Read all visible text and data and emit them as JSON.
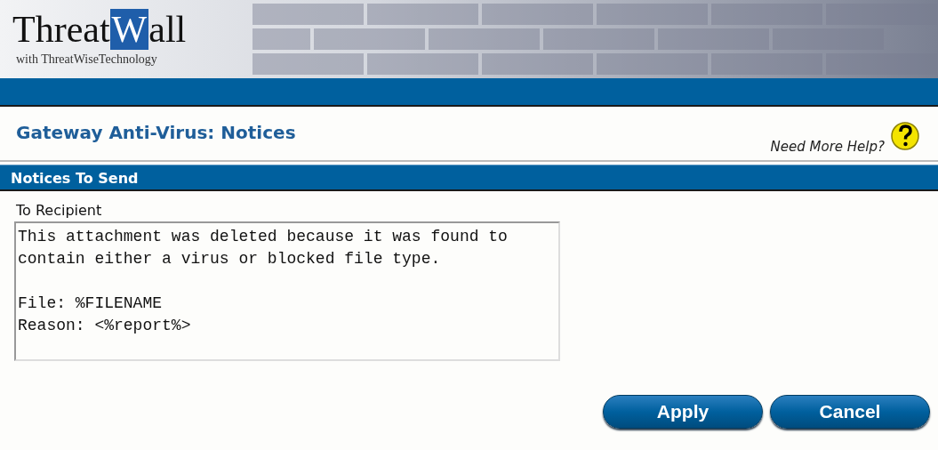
{
  "header": {
    "logo_parts": [
      "Threat",
      "W",
      "all"
    ],
    "tagline": "with ThreatWiseTechnology"
  },
  "page": {
    "title": "Gateway Anti-Virus: Notices",
    "help_link": "Need More Help?"
  },
  "section": {
    "title": "Notices To Send"
  },
  "fields": [
    {
      "label": "To Recipient",
      "value": "This attachment was deleted because it was found to\ncontain either a virus or blocked file type.\n\nFile: %FILENAME\nReason: <%report%>"
    }
  ],
  "buttons": [
    "Apply",
    "Cancel"
  ]
}
